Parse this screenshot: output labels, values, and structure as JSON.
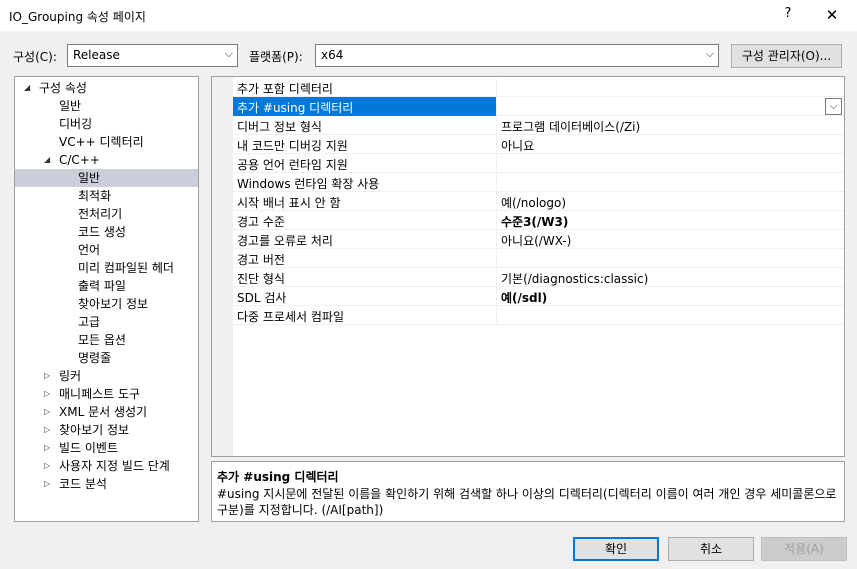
{
  "window": {
    "title": "IO_Grouping 속성 페이지",
    "help_glyph": "?",
    "close_glyph": "✕"
  },
  "config": {
    "config_label": "구성(C):",
    "config_value": "Release",
    "platform_label": "플랫폼(P):",
    "platform_value": "x64",
    "manager_button": "구성 관리자(O)..."
  },
  "tree": {
    "items": [
      {
        "label": "구성 속성",
        "level": 0,
        "expander": "◢",
        "selected": false
      },
      {
        "label": "일반",
        "level": 1,
        "expander": "",
        "selected": false
      },
      {
        "label": "디버깅",
        "level": 1,
        "expander": "",
        "selected": false
      },
      {
        "label": "VC++ 디렉터리",
        "level": 1,
        "expander": "",
        "selected": false
      },
      {
        "label": "C/C++",
        "level": 1,
        "expander": "◢",
        "selected": false
      },
      {
        "label": "일반",
        "level": 2,
        "expander": "",
        "selected": true
      },
      {
        "label": "최적화",
        "level": 2,
        "expander": "",
        "selected": false
      },
      {
        "label": "전처리기",
        "level": 2,
        "expander": "",
        "selected": false
      },
      {
        "label": "코드 생성",
        "level": 2,
        "expander": "",
        "selected": false
      },
      {
        "label": "언어",
        "level": 2,
        "expander": "",
        "selected": false
      },
      {
        "label": "미리 컴파일된 헤더",
        "level": 2,
        "expander": "",
        "selected": false
      },
      {
        "label": "출력 파일",
        "level": 2,
        "expander": "",
        "selected": false
      },
      {
        "label": "찾아보기 정보",
        "level": 2,
        "expander": "",
        "selected": false
      },
      {
        "label": "고급",
        "level": 2,
        "expander": "",
        "selected": false
      },
      {
        "label": "모든 옵션",
        "level": 2,
        "expander": "",
        "selected": false
      },
      {
        "label": "명령줄",
        "level": 2,
        "expander": "",
        "selected": false
      },
      {
        "label": "링커",
        "level": 1,
        "expander": "▷",
        "selected": false
      },
      {
        "label": "매니페스트 도구",
        "level": 1,
        "expander": "▷",
        "selected": false
      },
      {
        "label": "XML 문서 생성기",
        "level": 1,
        "expander": "▷",
        "selected": false
      },
      {
        "label": "찾아보기 정보",
        "level": 1,
        "expander": "▷",
        "selected": false
      },
      {
        "label": "빌드 이벤트",
        "level": 1,
        "expander": "▷",
        "selected": false
      },
      {
        "label": "사용자 지정 빌드 단계",
        "level": 1,
        "expander": "▷",
        "selected": false
      },
      {
        "label": "코드 분석",
        "level": 1,
        "expander": "▷",
        "selected": false
      }
    ]
  },
  "grid": {
    "dropdown_glyph": "⌵",
    "rows": [
      {
        "name": "추가 포함 디렉터리",
        "value": "",
        "bold": false,
        "selected": false
      },
      {
        "name": "추가 #using 디렉터리",
        "value": "",
        "bold": false,
        "selected": true
      },
      {
        "name": "디버그 정보 형식",
        "value": "프로그램 데이터베이스(/Zi)",
        "bold": false,
        "selected": false
      },
      {
        "name": "내 코드만 디버깅 지원",
        "value": "아니요",
        "bold": false,
        "selected": false
      },
      {
        "name": "공용 언어 런타임 지원",
        "value": "",
        "bold": false,
        "selected": false
      },
      {
        "name": "Windows 런타임 확장 사용",
        "value": "",
        "bold": false,
        "selected": false
      },
      {
        "name": "시작 배너 표시 안 함",
        "value": "예(/nologo)",
        "bold": false,
        "selected": false
      },
      {
        "name": "경고 수준",
        "value": "수준3(/W3)",
        "bold": true,
        "selected": false
      },
      {
        "name": "경고를 오류로 처리",
        "value": "아니요(/WX-)",
        "bold": false,
        "selected": false
      },
      {
        "name": "경고 버전",
        "value": "",
        "bold": false,
        "selected": false
      },
      {
        "name": "진단 형식",
        "value": "기본(/diagnostics:classic)",
        "bold": false,
        "selected": false
      },
      {
        "name": "SDL 검사",
        "value": "예(/sdl)",
        "bold": true,
        "selected": false
      },
      {
        "name": "다중 프로세서 컴파일",
        "value": "",
        "bold": false,
        "selected": false
      }
    ]
  },
  "description": {
    "title": "추가 #using 디렉터리",
    "text": "#using 지시문에 전달된 이름을 확인하기 위해 검색할 하나 이상의 디렉터리(디렉터리 이름이 여러 개인 경우 세미콜론으로 구분)를 지정합니다.  (/AI[path])"
  },
  "buttons": {
    "ok": "확인",
    "cancel": "취소",
    "apply": "적용(A)"
  }
}
